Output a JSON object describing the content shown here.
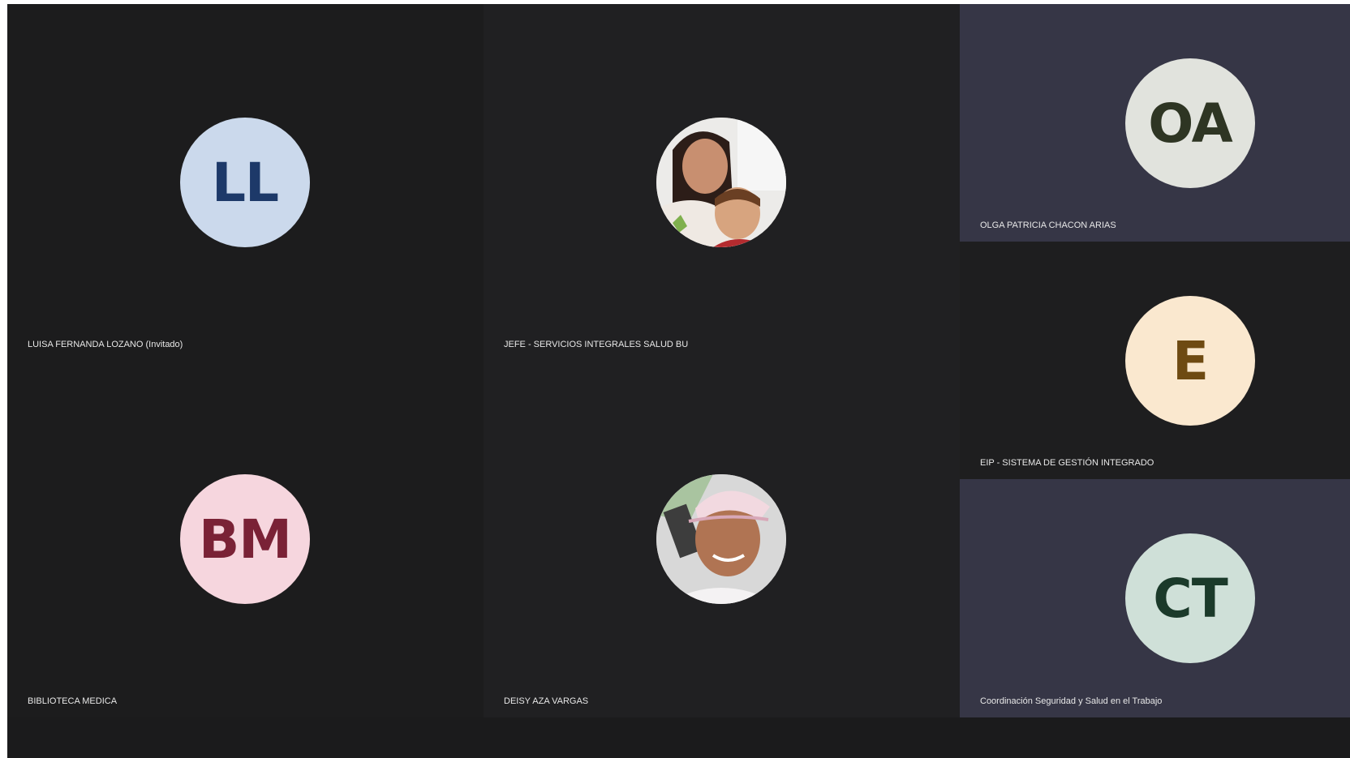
{
  "colors": {
    "stage_bg": "#1b1b1c",
    "tile_dark": "#1c1c1d",
    "tile_mid": "#202022",
    "tile_slate": "#363646",
    "name_text": "#e8e8e8"
  },
  "participants": [
    {
      "name": "LUISA  FERNANDA LOZANO (Invitado)",
      "initials": "LL",
      "avatar_bg": "#cbd9ec",
      "avatar_fg": "#1d3969"
    },
    {
      "name": "JEFE  - SERVICIOS INTEGRALES SALUD BU",
      "initials": "",
      "avatar_type": "photo"
    },
    {
      "name": "OLGA PATRICIA CHACON ARIAS",
      "initials": "OA",
      "avatar_bg": "#e1e3dd",
      "avatar_fg": "#2e3523"
    },
    {
      "name": "EIP - SISTEMA DE GESTIÓN INTEGRADO",
      "initials": "E",
      "avatar_bg": "#fae8cf",
      "avatar_fg": "#6e4a12"
    },
    {
      "name": "BIBLIOTECA MEDICA",
      "initials": "BM",
      "avatar_bg": "#f6d6de",
      "avatar_fg": "#7a2236"
    },
    {
      "name": "DEISY AZA VARGAS",
      "initials": "",
      "avatar_type": "photo"
    },
    {
      "name": "Coordinación Seguridad y Salud en el Trabajo",
      "initials": "CT",
      "avatar_bg": "#cfe0d8",
      "avatar_fg": "#1b3a2a"
    }
  ]
}
